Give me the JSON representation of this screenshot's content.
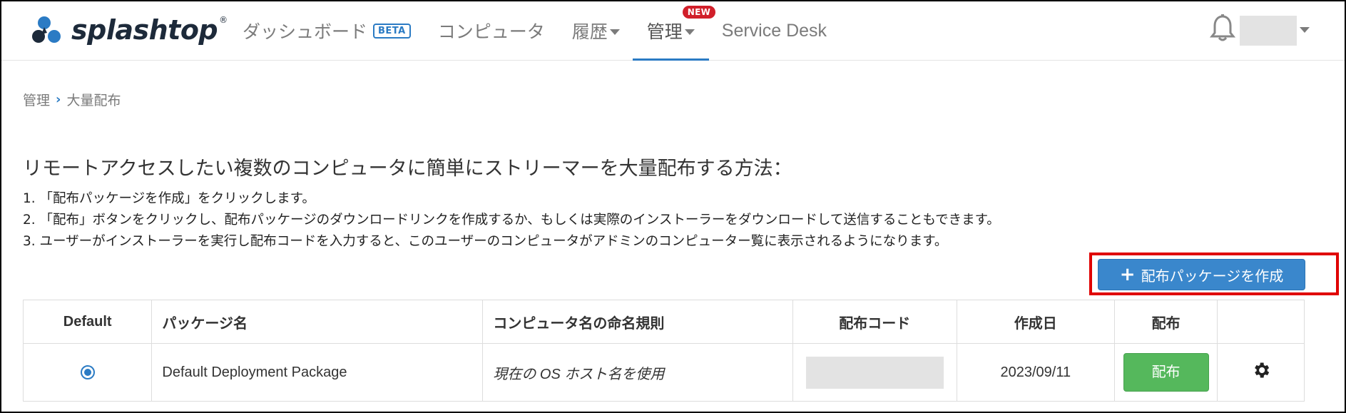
{
  "brand": {
    "name": "splashtop",
    "reg": "®"
  },
  "nav": {
    "dashboard": "ダッシュボード",
    "beta": "BETA",
    "computers": "コンピュータ",
    "history": "履歴",
    "manage": "管理",
    "new_badge": "NEW",
    "service_desk": "Service Desk"
  },
  "breadcrumb": {
    "parent": "管理",
    "current": "大量配布"
  },
  "heading": "リモートアクセスしたい複数のコンピュータに簡単にストリーマーを大量配布する方法：",
  "steps": [
    "1. 「配布パッケージを作成」をクリックします。",
    "2. 「配布」ボタンをクリックし、配布パッケージのダウンロードリンクを作成するか、もしくは実際のインストーラーをダウンロードして送信することもできます。",
    "3. ユーザーがインストーラーを実行し配布コードを入力すると、このユーザーのコンピュータがアドミンのコンピューター覧に表示されるようになります。"
  ],
  "create_button": {
    "label": "配布パッケージを作成"
  },
  "table": {
    "headers": {
      "default": "Default",
      "package_name": "パッケージ名",
      "naming_rule": "コンピュータ名の命名規則",
      "deploy_code": "配布コード",
      "created": "作成日",
      "deploy": "配布"
    },
    "rows": [
      {
        "package_name": "Default Deployment Package",
        "naming_rule": "現在の OS ホスト名を使用",
        "created": "2023/09/11",
        "deploy_label": "配布"
      }
    ]
  },
  "colors": {
    "accent": "#2b7bc4",
    "deploy_green": "#55b85c",
    "highlight_red": "#e00000",
    "new_red": "#d11f2a"
  }
}
